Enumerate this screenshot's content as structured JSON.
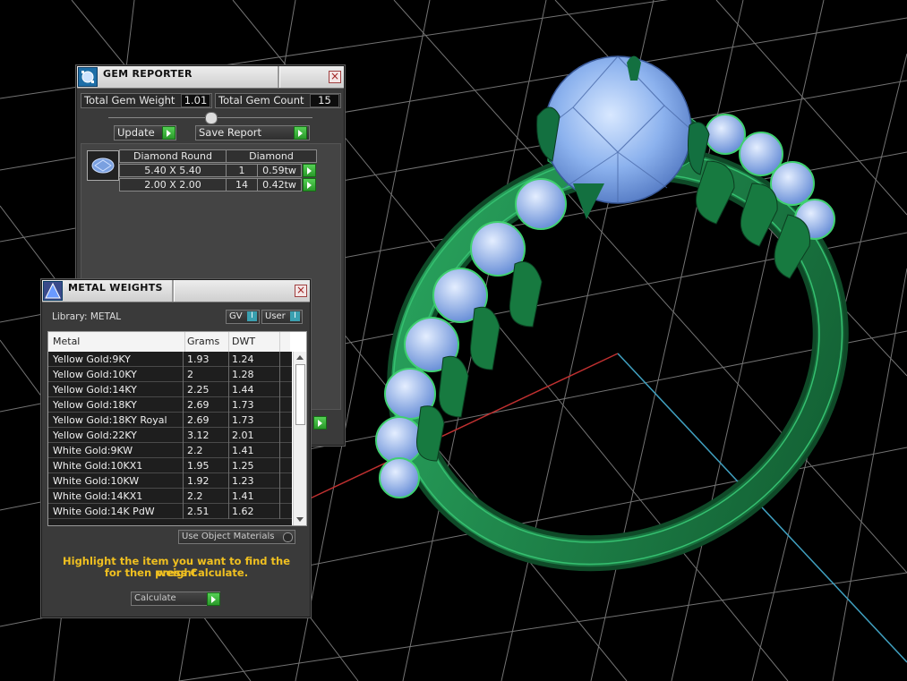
{
  "gem_reporter": {
    "title": "GEM REPORTER",
    "close": "×",
    "total_gem_weight_label": "Total Gem Weight",
    "total_gem_weight_value": "1.01",
    "total_gem_count_label": "Total Gem Count",
    "total_gem_count_value": "15",
    "update_label": "Update",
    "save_report_label": "Save Report",
    "gem_table": {
      "header_shape": "Diamond Round",
      "header_material": "Diamond",
      "rows": [
        {
          "size": "5.40 X 5.40",
          "count": "1",
          "weight": "0.59tw"
        },
        {
          "size": "2.00 X 2.00",
          "count": "14",
          "weight": "0.42tw"
        }
      ]
    }
  },
  "metal_weights": {
    "title": "METAL WEIGHTS",
    "close": "×",
    "library_label": "Library: METAL",
    "gv_label": "GV",
    "user_label": "User",
    "columns": [
      "Metal",
      "Grams",
      "DWT"
    ],
    "rows": [
      [
        "Yellow Gold:9KY",
        "1.93",
        "1.24"
      ],
      [
        "Yellow Gold:10KY",
        "2",
        "1.28"
      ],
      [
        "Yellow Gold:14KY",
        "2.25",
        "1.44"
      ],
      [
        "Yellow Gold:18KY",
        "2.69",
        "1.73"
      ],
      [
        "Yellow Gold:18KY Royal",
        "2.69",
        "1.73"
      ],
      [
        "Yellow Gold:22KY",
        "3.12",
        "2.01"
      ],
      [
        "White Gold:9KW",
        "2.2",
        "1.41"
      ],
      [
        "White Gold:10KX1",
        "1.95",
        "1.25"
      ],
      [
        "White Gold:10KW",
        "1.92",
        "1.23"
      ],
      [
        "White Gold:14KX1",
        "2.2",
        "1.41"
      ],
      [
        "White Gold:14K PdW",
        "2.51",
        "1.62"
      ]
    ],
    "use_object_materials_label": "Use Object Materials",
    "hint_line1": "Highlight the item you want to find the weight",
    "hint_line2": "for then press Calculate.",
    "calculate_label": "Calculate"
  },
  "colors": {
    "accent_green": "#3cbc3c",
    "hint_yellow": "#f0c020",
    "ring_green": "#1f8a4a",
    "gem_blue": "#8ab4f0"
  }
}
